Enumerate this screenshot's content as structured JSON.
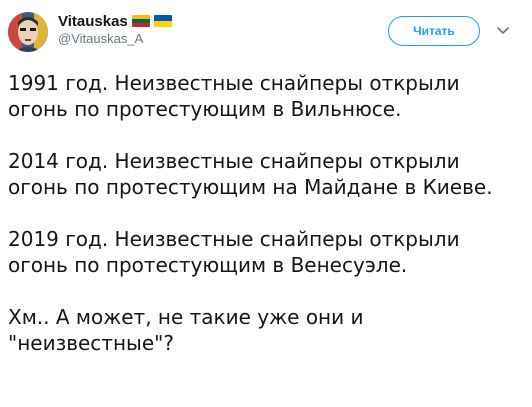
{
  "tweet": {
    "author": {
      "display_name": "Vitauskas",
      "handle": "@Vitauskas_A",
      "avatar_icon": "avatar-portrait-icon",
      "flags": [
        {
          "name": "lithuania-flag-icon",
          "colors": [
            "#fdb913",
            "#006a44",
            "#c1272d"
          ]
        },
        {
          "name": "ukraine-flag-icon",
          "colors": [
            "#0057b7",
            "#ffd700"
          ]
        }
      ]
    },
    "follow_label": "Читать",
    "menu_icon": "chevron-down-icon",
    "paragraphs": [
      "1991 год. Неизвестные снайперы открыли огонь по протестующим в Вильнюсе.",
      "2014 год. Неизвестные снайперы открыли огонь по протестующим на Майдане в Киеве.",
      "2019 год. Неизвестные снайперы открыли огонь по протестующим в Венесуэле.",
      "Хм.. А может, не такие уже они и \"неизвестные\"?"
    ]
  },
  "colors": {
    "accent": "#1da1f2",
    "text": "#14171a",
    "secondary_text": "#657786"
  }
}
